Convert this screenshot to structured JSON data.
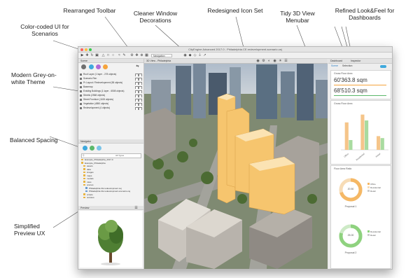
{
  "callouts": {
    "color_ui": "Color-coded UI for Scenarios",
    "toolbar": "Rearranged Toolbar",
    "window_decorations": "Cleaner Window Decorations",
    "icon_set": "Redesigned Icon Set",
    "menubar": "Tidy 3D  View Menubar",
    "dashboards": "Refined Look&Feel for Dashboards",
    "theme": "Modern Grey-on-white Theme",
    "spacing": "Balanced Spacing",
    "preview": "Simplified Preview UX"
  },
  "window": {
    "title": "CityEngine Advanced 2017.0 - Philadelphia.CE.redevelopment-scenario.cej"
  },
  "toolbar": {
    "combo_label": "Navigation"
  },
  "scene_editor": {
    "title": "Scene",
    "layers": [
      "Roof Layer (1 layer - 278 objects)",
      "Scenario Ren",
      "Pr Layout / Redevelopment (58 objects)",
      "Basemap",
      "Existing Buildings (1 layer - 6508 objects)",
      "Streets (2568 objects)",
      "Street Furniture (1108 objects)",
      "Vegetation (4850 objects)",
      "Redevelopment (4 objects)"
    ]
  },
  "navigator": {
    "title": "Navigator",
    "search_placeholder": "All Types",
    "items": [
      "Example_Philadelphia_2017.0",
      "Example_Philadelphia",
      "assets",
      "data",
      "images",
      "maps",
      "models",
      "rules",
      "scenes",
      "Philadelphia.CE.redevelopment.cej",
      "Philadelphia.CE.redevelopment-scenario.cej",
      "scripts",
      "textures"
    ]
  },
  "preview": {
    "title": "Preview"
  },
  "viewport": {
    "tab": "3D View - Philadelphia",
    "colors": {
      "sky": "#b9c6d4",
      "highlight": "#f6c56e"
    }
  },
  "dashboard": {
    "title": "Dashboard",
    "inspector_tab": "Inspector",
    "tabs": [
      "Scene",
      "Selection"
    ],
    "gfa_title": "Gross Floor Area",
    "gfa_values": [
      "60'363.8 sqm",
      "68'510.3 sqm"
    ],
    "chart_title": "Gross Floor Area",
    "ratio_title": "Floor Area Ratio",
    "ratio_values": [
      "20.50",
      "25.00"
    ],
    "ratio_legend": [
      "Office",
      "Residential",
      "Retail"
    ],
    "proposals": [
      "Proposal 1",
      "Proposal 2"
    ]
  },
  "chart_data": {
    "type": "bar",
    "categories": [
      "Office",
      "Residential",
      "Retail"
    ],
    "series": [
      {
        "name": "",
        "values": [
          70,
          90,
          35
        ]
      },
      {
        "name": "",
        "values": [
          25,
          75,
          30
        ]
      }
    ],
    "ylim": [
      0,
      100
    ],
    "colors": [
      "#f5c58a",
      "#a9dba0"
    ]
  }
}
